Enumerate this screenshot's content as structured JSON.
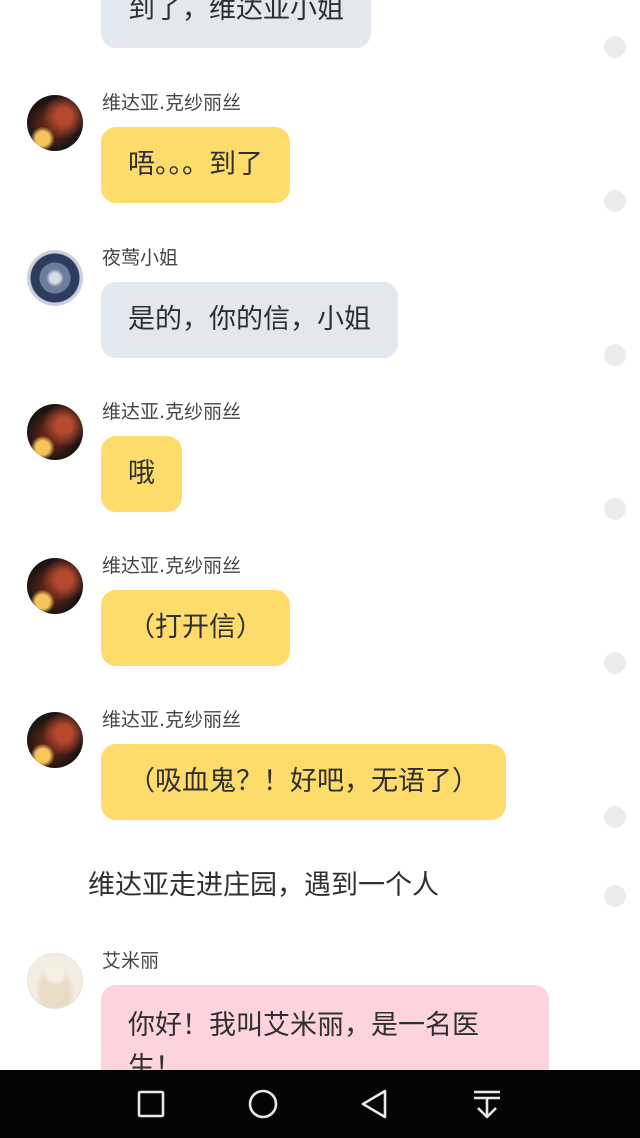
{
  "messages": [
    {
      "bubble_text": "到了，维达亚小姐"
    },
    {
      "sender": "维达亚.克纱丽丝",
      "bubble_text": "唔。。。到了"
    },
    {
      "sender": "夜莺小姐",
      "bubble_text": "是的，你的信，小姐"
    },
    {
      "sender": "维达亚.克纱丽丝",
      "bubble_text": "哦"
    },
    {
      "sender": "维达亚.克纱丽丝",
      "bubble_text": "（打开信）"
    },
    {
      "sender": "维达亚.克纱丽丝",
      "bubble_text": "（吸血鬼？！好吧，无语了）"
    },
    {
      "narration": "维达亚走进庄园，遇到一个人"
    },
    {
      "sender": "艾米丽",
      "bubble_text": "你好！我叫艾米丽，是一名医生！"
    }
  ],
  "navbar": {
    "buttons": [
      "recent-apps",
      "home",
      "back",
      "notification-pulldown"
    ]
  },
  "colors": {
    "bubble_gray": "#e3e8f0",
    "bubble_yellow": "#fedc6c",
    "bubble_pink": "#fdd3de",
    "navbar_bg": "#050505"
  }
}
